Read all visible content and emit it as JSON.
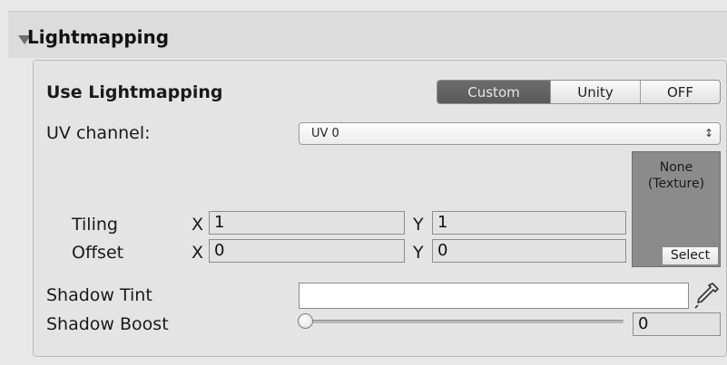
{
  "section": {
    "title": "Lightmapping"
  },
  "use_lightmapping": {
    "label": "Use Lightmapping",
    "options": [
      "Custom",
      "Unity",
      "OFF"
    ],
    "selected": "Custom"
  },
  "uv_channel": {
    "label": "UV channel:",
    "value": "UV 0",
    "arrow": "↕"
  },
  "tiling": {
    "label": "Tiling",
    "x_label": "X",
    "x": "1",
    "y_label": "Y",
    "y": "1"
  },
  "offset": {
    "label": "Offset",
    "x_label": "X",
    "x": "0",
    "y_label": "Y",
    "y": "0"
  },
  "texture": {
    "label_line1": "None",
    "label_line2": "(Texture)",
    "select_label": "Select"
  },
  "shadow_tint": {
    "label": "Shadow Tint",
    "color": "#ffffff",
    "eyedropper_icon": "eyedropper-icon"
  },
  "shadow_boost": {
    "label": "Shadow Boost",
    "value": "0",
    "slider_fraction": 0
  },
  "colors": {
    "background": "#e8e8e8",
    "active_segment": "#5f5f5f",
    "texture_slot": "#8b8b8b"
  }
}
